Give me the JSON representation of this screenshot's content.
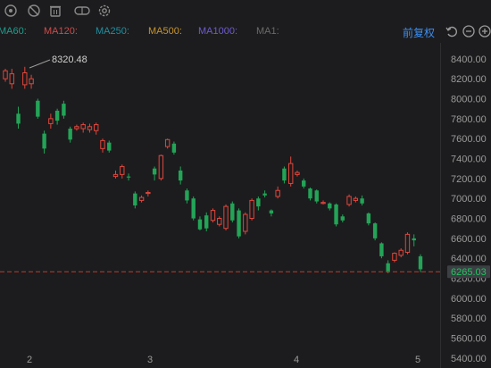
{
  "toolbar": {
    "icons": [
      "cross-eye-icon",
      "hide-icon",
      "trash-icon",
      "link-icon",
      "gear-icon"
    ]
  },
  "ma_legend": [
    {
      "label": "MA60:",
      "color": "#1f9e8e"
    },
    {
      "label": "MA120:",
      "color": "#d04a4a"
    },
    {
      "label": "MA250:",
      "color": "#1e8fa0"
    },
    {
      "label": "MA500:",
      "color": "#c9942a"
    },
    {
      "label": "MA1000:",
      "color": "#6e5bd0"
    },
    {
      "label": "MA1:",
      "color": "#6a6a6a"
    }
  ],
  "adjust_button": "前复权",
  "colors": {
    "up": "#e0463c",
    "down": "#23a457",
    "ref_line": "#c0392b",
    "price_tag_bg": "#3c3f44",
    "price_tag_text": "#22c55e"
  },
  "chart_data": {
    "type": "candlestick",
    "ylim": [
      5300,
      8560
    ],
    "y_ticks": [
      "8400.00",
      "8200.00",
      "8000.00",
      "7800.00",
      "7600.00",
      "7400.00",
      "7200.00",
      "7000.00",
      "6800.00",
      "6600.00",
      "6400.00",
      "6200.00",
      "6000.00",
      "5800.00",
      "5600.00",
      "5400.00"
    ],
    "x_ticks": [
      "2",
      "3",
      "4",
      "5"
    ],
    "high_annotation": "8320.48",
    "current_price": "6265.03",
    "current_value": 6265.03,
    "candles": [
      [
        8200,
        8280,
        8170,
        8300
      ],
      [
        8150,
        8250,
        8100,
        8300
      ],
      [
        7850,
        7750,
        7700,
        7920
      ],
      [
        8140,
        8260,
        8100,
        8320
      ],
      [
        8150,
        8200,
        8100,
        8240
      ],
      [
        7980,
        7820,
        7800,
        8000
      ],
      [
        7650,
        7500,
        7450,
        7680
      ],
      [
        7750,
        7800,
        7700,
        7850
      ],
      [
        7880,
        7780,
        7740,
        7900
      ],
      [
        7950,
        7830,
        7800,
        7980
      ],
      [
        7700,
        7590,
        7560,
        7720
      ],
      [
        7700,
        7720,
        7680,
        7740
      ],
      [
        7700,
        7740,
        7660,
        7760
      ],
      [
        7690,
        7720,
        7660,
        7750
      ],
      [
        7680,
        7740,
        7640,
        7760
      ],
      [
        7500,
        7580,
        7460,
        7600
      ],
      [
        7560,
        7480,
        7460,
        7580
      ],
      [
        7220,
        7240,
        7200,
        7280
      ],
      [
        7240,
        7320,
        7200,
        7340
      ],
      [
        7220,
        7210,
        7180,
        7250
      ],
      [
        7050,
        6930,
        6900,
        7070
      ],
      [
        6980,
        7010,
        6960,
        7030
      ],
      [
        7050,
        7060,
        7020,
        7080
      ],
      [
        7300,
        7240,
        7180,
        7320
      ],
      [
        7200,
        7430,
        7180,
        7440
      ],
      [
        7520,
        7590,
        7500,
        7600
      ],
      [
        7550,
        7460,
        7440,
        7570
      ],
      [
        7280,
        7180,
        7140,
        7320
      ],
      [
        7080,
        6980,
        6950,
        7100
      ],
      [
        7000,
        6800,
        6780,
        7020
      ],
      [
        6790,
        6690,
        6680,
        6820
      ],
      [
        6830,
        6700,
        6670,
        6860
      ],
      [
        6780,
        6880,
        6760,
        6900
      ],
      [
        6740,
        6800,
        6720,
        6820
      ],
      [
        6700,
        6920,
        6680,
        6940
      ],
      [
        6950,
        6780,
        6760,
        6970
      ],
      [
        6880,
        6620,
        6600,
        6900
      ],
      [
        6670,
        6840,
        6640,
        6860
      ],
      [
        6800,
        6980,
        6780,
        7000
      ],
      [
        7000,
        6920,
        6880,
        7020
      ],
      [
        7050,
        7030,
        7010,
        7080
      ],
      [
        6880,
        6850,
        6820,
        6890
      ],
      [
        7020,
        7080,
        7000,
        7120
      ],
      [
        7300,
        7180,
        7150,
        7320
      ],
      [
        7150,
        7350,
        7120,
        7420
      ],
      [
        7240,
        7260,
        7220,
        7280
      ],
      [
        7180,
        7120,
        7100,
        7200
      ],
      [
        7100,
        7000,
        6980,
        7110
      ],
      [
        7080,
        6970,
        6950,
        7090
      ],
      [
        6950,
        6960,
        6940,
        6980
      ],
      [
        6950,
        6900,
        6880,
        6960
      ],
      [
        6940,
        6740,
        6720,
        6950
      ],
      [
        6820,
        6780,
        6760,
        6840
      ],
      [
        6940,
        7020,
        6920,
        7040
      ],
      [
        6980,
        7000,
        6960,
        7020
      ],
      [
        7000,
        6950,
        6930,
        7030
      ],
      [
        6850,
        6750,
        6730,
        6860
      ],
      [
        6750,
        6600,
        6580,
        6760
      ],
      [
        6550,
        6420,
        6400,
        6560
      ],
      [
        6350,
        6270,
        6250,
        6380
      ],
      [
        6380,
        6450,
        6360,
        6460
      ],
      [
        6430,
        6480,
        6410,
        6500
      ],
      [
        6460,
        6640,
        6440,
        6660
      ],
      [
        6600,
        6580,
        6520,
        6640
      ],
      [
        6420,
        6290,
        6260,
        6440
      ]
    ]
  }
}
